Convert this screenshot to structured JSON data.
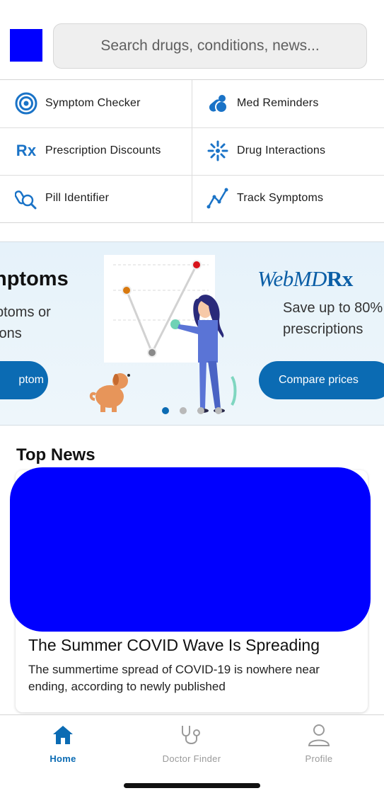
{
  "search": {
    "placeholder": "Search drugs, conditions, news..."
  },
  "quick_links": [
    {
      "label": "Symptom Checker",
      "icon": "target-icon"
    },
    {
      "label": "Med Reminders",
      "icon": "pills-icon"
    },
    {
      "label": "Prescription Discounts",
      "icon": "rx-icon"
    },
    {
      "label": "Drug Interactions",
      "icon": "interaction-icon"
    },
    {
      "label": "Pill Identifier",
      "icon": "pill-search-icon"
    },
    {
      "label": "Track Symptoms",
      "icon": "trend-line-icon"
    }
  ],
  "banner": {
    "left_title": "nptoms",
    "left_text_line1": "ptoms or",
    "left_text_line2": "ions",
    "left_button": "ptom",
    "brand_web": "WebMD",
    "brand_rx": "Rx",
    "right_text_line1": "Save up to 80%",
    "right_text_line2": "prescriptions",
    "right_button": "Compare prices",
    "active_slide": 1,
    "slide_count": 4
  },
  "news": {
    "heading": "Top News",
    "article_title": "The Summer COVID Wave Is Spreading",
    "article_desc": "The summertime spread of COVID-19 is nowhere near ending, according to newly published"
  },
  "bottom_nav": [
    {
      "label": "Home",
      "icon": "home-icon",
      "active": true
    },
    {
      "label": "Doctor Finder",
      "icon": "stethoscope-icon",
      "active": false
    },
    {
      "label": "Profile",
      "icon": "person-icon",
      "active": false
    }
  ],
  "colors": {
    "brand_blue": "#0b6bb3",
    "placeholder_blue": "#0000ff"
  }
}
